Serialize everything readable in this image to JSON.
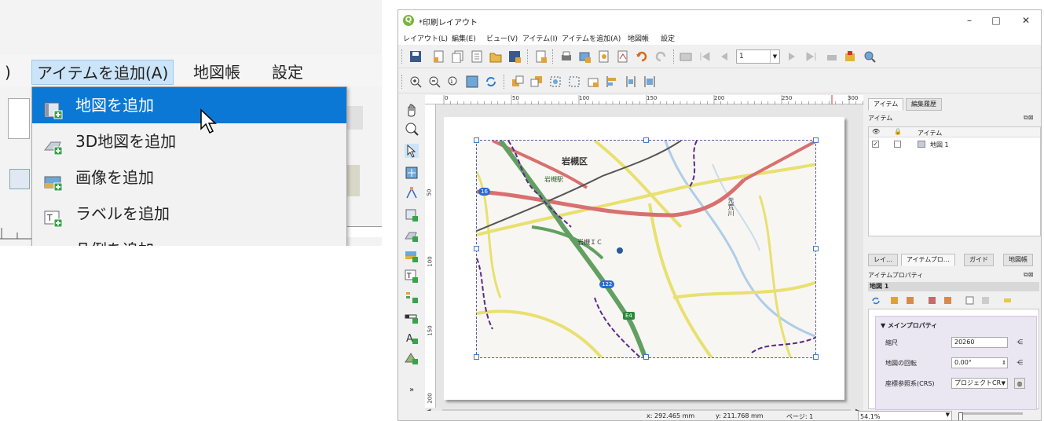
{
  "crop": {
    "menubar": {
      "left_fragment": ")",
      "add_item": "アイテムを追加(A)",
      "atlas": "地図帳",
      "settings": "設定"
    },
    "menu_items": [
      {
        "label": "地図を追加",
        "icon": "add-map-icon",
        "highlighted": true
      },
      {
        "label": "3D地図を追加",
        "icon": "add-3d-map-icon",
        "highlighted": false
      },
      {
        "label": "画像を追加",
        "icon": "add-image-icon",
        "highlighted": false
      },
      {
        "label": "ラベルを追加",
        "icon": "add-label-icon",
        "highlighted": false
      },
      {
        "label": "凡例を追加",
        "icon": "add-legend-icon",
        "highlighted": false
      }
    ]
  },
  "window": {
    "title": "*印刷レイアウト",
    "controls": {
      "minimize": "–",
      "maximize": "□",
      "close": "✕"
    },
    "menu": [
      "レイアウト(L)",
      "編集(E)",
      "ビュー(V)",
      "アイテム(I)",
      "アイテムを追加(A)",
      "地図帳",
      "設定"
    ],
    "page_value": "1",
    "ruler_h": [
      "0",
      "50",
      "100",
      "150",
      "200",
      "250",
      "300"
    ],
    "ruler_v": [
      "50",
      "100",
      "150",
      "200"
    ],
    "map_labels": {
      "ward": "岩槻区",
      "station": "岩槻駅",
      "interchange": "岩槻ＩＣ",
      "river": "元荒川",
      "route16": "16",
      "route122": "122",
      "e4": "E4"
    },
    "status": {
      "x": "x: 292.465 mm",
      "y": "y: 211.768 mm",
      "page": "ページ: 1",
      "zoom": "54.1%"
    },
    "items_panel": {
      "tabs": [
        "アイテム",
        "編集履歴"
      ],
      "title": "アイテム",
      "column": "アイテム",
      "rows": [
        {
          "name": "地図 1",
          "visible": "✓"
        }
      ]
    },
    "props_panel": {
      "tabs": [
        "レイ…",
        "アイテムプロ…",
        "ガイド",
        "地図帳"
      ],
      "title": "アイテムプロパティ",
      "item_name": "地図 1",
      "section": "メインプロパティ",
      "scale_label": "縮尺",
      "scale_value": "20260",
      "rotation_label": "地図の回転",
      "rotation_value": "0.00°",
      "crs_label": "座標参照系(CRS)",
      "crs_value": "プロジェクトCR"
    },
    "colors": {
      "accent": "#0a78d4",
      "highway": "#5a9e5a",
      "road_red": "#d86a6a",
      "road_yellow": "#e0d84a",
      "boundary": "#5a2a8a",
      "river": "#9ec4e4"
    }
  }
}
